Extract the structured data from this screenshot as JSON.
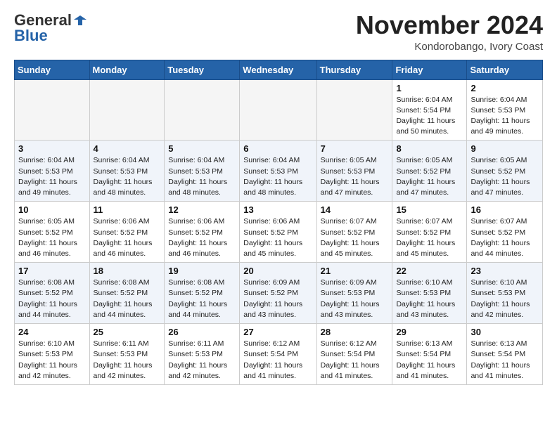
{
  "header": {
    "logo_general": "General",
    "logo_blue": "Blue",
    "month_title": "November 2024",
    "location": "Kondorobango, Ivory Coast"
  },
  "days_of_week": [
    "Sunday",
    "Monday",
    "Tuesday",
    "Wednesday",
    "Thursday",
    "Friday",
    "Saturday"
  ],
  "weeks": [
    [
      {
        "day": "",
        "info": ""
      },
      {
        "day": "",
        "info": ""
      },
      {
        "day": "",
        "info": ""
      },
      {
        "day": "",
        "info": ""
      },
      {
        "day": "",
        "info": ""
      },
      {
        "day": "1",
        "info": "Sunrise: 6:04 AM\nSunset: 5:54 PM\nDaylight: 11 hours\nand 50 minutes."
      },
      {
        "day": "2",
        "info": "Sunrise: 6:04 AM\nSunset: 5:53 PM\nDaylight: 11 hours\nand 49 minutes."
      }
    ],
    [
      {
        "day": "3",
        "info": "Sunrise: 6:04 AM\nSunset: 5:53 PM\nDaylight: 11 hours\nand 49 minutes."
      },
      {
        "day": "4",
        "info": "Sunrise: 6:04 AM\nSunset: 5:53 PM\nDaylight: 11 hours\nand 48 minutes."
      },
      {
        "day": "5",
        "info": "Sunrise: 6:04 AM\nSunset: 5:53 PM\nDaylight: 11 hours\nand 48 minutes."
      },
      {
        "day": "6",
        "info": "Sunrise: 6:04 AM\nSunset: 5:53 PM\nDaylight: 11 hours\nand 48 minutes."
      },
      {
        "day": "7",
        "info": "Sunrise: 6:05 AM\nSunset: 5:53 PM\nDaylight: 11 hours\nand 47 minutes."
      },
      {
        "day": "8",
        "info": "Sunrise: 6:05 AM\nSunset: 5:52 PM\nDaylight: 11 hours\nand 47 minutes."
      },
      {
        "day": "9",
        "info": "Sunrise: 6:05 AM\nSunset: 5:52 PM\nDaylight: 11 hours\nand 47 minutes."
      }
    ],
    [
      {
        "day": "10",
        "info": "Sunrise: 6:05 AM\nSunset: 5:52 PM\nDaylight: 11 hours\nand 46 minutes."
      },
      {
        "day": "11",
        "info": "Sunrise: 6:06 AM\nSunset: 5:52 PM\nDaylight: 11 hours\nand 46 minutes."
      },
      {
        "day": "12",
        "info": "Sunrise: 6:06 AM\nSunset: 5:52 PM\nDaylight: 11 hours\nand 46 minutes."
      },
      {
        "day": "13",
        "info": "Sunrise: 6:06 AM\nSunset: 5:52 PM\nDaylight: 11 hours\nand 45 minutes."
      },
      {
        "day": "14",
        "info": "Sunrise: 6:07 AM\nSunset: 5:52 PM\nDaylight: 11 hours\nand 45 minutes."
      },
      {
        "day": "15",
        "info": "Sunrise: 6:07 AM\nSunset: 5:52 PM\nDaylight: 11 hours\nand 45 minutes."
      },
      {
        "day": "16",
        "info": "Sunrise: 6:07 AM\nSunset: 5:52 PM\nDaylight: 11 hours\nand 44 minutes."
      }
    ],
    [
      {
        "day": "17",
        "info": "Sunrise: 6:08 AM\nSunset: 5:52 PM\nDaylight: 11 hours\nand 44 minutes."
      },
      {
        "day": "18",
        "info": "Sunrise: 6:08 AM\nSunset: 5:52 PM\nDaylight: 11 hours\nand 44 minutes."
      },
      {
        "day": "19",
        "info": "Sunrise: 6:08 AM\nSunset: 5:52 PM\nDaylight: 11 hours\nand 44 minutes."
      },
      {
        "day": "20",
        "info": "Sunrise: 6:09 AM\nSunset: 5:52 PM\nDaylight: 11 hours\nand 43 minutes."
      },
      {
        "day": "21",
        "info": "Sunrise: 6:09 AM\nSunset: 5:53 PM\nDaylight: 11 hours\nand 43 minutes."
      },
      {
        "day": "22",
        "info": "Sunrise: 6:10 AM\nSunset: 5:53 PM\nDaylight: 11 hours\nand 43 minutes."
      },
      {
        "day": "23",
        "info": "Sunrise: 6:10 AM\nSunset: 5:53 PM\nDaylight: 11 hours\nand 42 minutes."
      }
    ],
    [
      {
        "day": "24",
        "info": "Sunrise: 6:10 AM\nSunset: 5:53 PM\nDaylight: 11 hours\nand 42 minutes."
      },
      {
        "day": "25",
        "info": "Sunrise: 6:11 AM\nSunset: 5:53 PM\nDaylight: 11 hours\nand 42 minutes."
      },
      {
        "day": "26",
        "info": "Sunrise: 6:11 AM\nSunset: 5:53 PM\nDaylight: 11 hours\nand 42 minutes."
      },
      {
        "day": "27",
        "info": "Sunrise: 6:12 AM\nSunset: 5:54 PM\nDaylight: 11 hours\nand 41 minutes."
      },
      {
        "day": "28",
        "info": "Sunrise: 6:12 AM\nSunset: 5:54 PM\nDaylight: 11 hours\nand 41 minutes."
      },
      {
        "day": "29",
        "info": "Sunrise: 6:13 AM\nSunset: 5:54 PM\nDaylight: 11 hours\nand 41 minutes."
      },
      {
        "day": "30",
        "info": "Sunrise: 6:13 AM\nSunset: 5:54 PM\nDaylight: 11 hours\nand 41 minutes."
      }
    ]
  ]
}
